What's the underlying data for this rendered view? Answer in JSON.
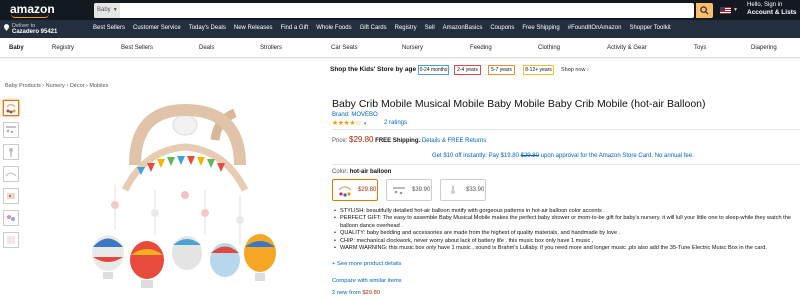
{
  "header": {
    "logo": "amazon",
    "search_dept": "Baby",
    "signin_line1": "Hello, Sign in",
    "signin_line2": "Account & Lists"
  },
  "deliver": {
    "line1": "Deliver to",
    "line2": "Cazadero 95421"
  },
  "nav_links": [
    "Best Sellers",
    "Customer Service",
    "Today's Deals",
    "New Releases",
    "Find a Gift",
    "Whole Foods",
    "Gift Cards",
    "Registry",
    "Sell",
    "AmazonBasics",
    "Coupons",
    "Free Shipping",
    "#FoundItOnAmazon",
    "Shopper Toolkit"
  ],
  "categories": [
    "Baby",
    "Registry",
    "Best Sellers",
    "Deals",
    "Strollers",
    "Car Seats",
    "Nursery",
    "Feeding",
    "Clothing",
    "Activity & Gear",
    "Toys",
    "Diapering"
  ],
  "kids_store": {
    "title": "Shop the Kids' Store by age",
    "ages": [
      {
        "label": "0-24 months",
        "color": "#4aa3df"
      },
      {
        "label": "2-4 years",
        "color": "#e3464a"
      },
      {
        "label": "5-7 years",
        "color": "#f08c2c"
      },
      {
        "label": "8-12+ years",
        "color": "#f2c12e"
      }
    ],
    "shop_now": "Shop now ›"
  },
  "breadcrumb": [
    "Baby Products",
    "Nursery",
    "Décor",
    "Mobiles"
  ],
  "product": {
    "title": "Baby Crib Mobile Musical Mobile Baby Mobile Baby Crib Mobile (hot-air Balloon)",
    "brand": "Brand: MOVEBO",
    "ratings": "2 ratings",
    "price_label": "Price:",
    "price": "$29.80",
    "shipping": "FREE Shipping.",
    "details": "Details",
    "returns": "& FREE Returns",
    "promo_pre": "Get $10 off instantly: Pay $19.80",
    "promo_strike": "$29.80",
    "promo_post": "upon approval for the Amazon Store Card. No annual fee.",
    "color_label": "Color:",
    "color_value": "hot-air balloon",
    "swatches": [
      "$29.80",
      "$39.90",
      "$33.90"
    ],
    "bullets": [
      "STYLISH: beautifully detailed hot-air balloon motify with gorgeous patterns in hot-air balloon color accents .",
      "PERFECT GIFT: The easy to assemble Baby Musical Mobile makes the perfect baby shower or mom-to-be gift for baby's nursery. it will lull your little one to sleep-while they watch the balloon dance overhead .",
      "QUALITY: baby bedding and accessories are made from the highest of quality materials, and handmade by love .",
      "CHIP: mechanical clockwork, never worry about lack of battery life . this music box only have 1 music ,",
      "WARM WARNING: this music box only have 1 music , sound is Brahm's Lullaby. if you need more and longer music ,pls also add the 35-Tune Electric Muisc Box in the card."
    ],
    "see_more": "+ See more product details",
    "compare": "Compare with similar items",
    "new_from_pre": "2 new from",
    "new_from_price": "$29.80"
  },
  "colors": {
    "nav_dark": "#131921",
    "nav_mid": "#232f3e",
    "accent": "#febd69",
    "link": "#0066c0",
    "price": "#b12704",
    "star": "#f0a000"
  }
}
